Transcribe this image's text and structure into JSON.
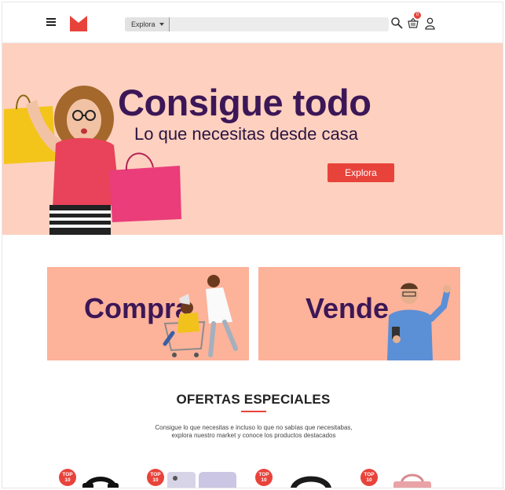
{
  "header": {
    "search": {
      "category": "Explora",
      "placeholder": ""
    },
    "cart_count": "0"
  },
  "hero": {
    "title": "Consigue todo",
    "subtitle": "Lo que necesitas desde casa",
    "button_label": "Explora"
  },
  "promos": [
    {
      "label": "Compra"
    },
    {
      "label": "Vende"
    }
  ],
  "ofertas": {
    "title": "OFERTAS ESPECIALES",
    "description_line1": "Consigue lo que necesitas e incluso lo que no sabías que necesitabas,",
    "description_line2": "explora nuestro market y conoce los productos destacados"
  },
  "products": [
    {
      "badge_top": "TOP",
      "badge_bottom": "10",
      "icon": "headphones-icon"
    },
    {
      "badge_top": "TOP",
      "badge_bottom": "10",
      "icon": "phone-icon"
    },
    {
      "badge_top": "TOP",
      "badge_bottom": "10",
      "icon": "smartwatch-icon"
    },
    {
      "badge_top": "TOP",
      "badge_bottom": "10",
      "icon": "handbag-icon"
    }
  ],
  "colors": {
    "accent": "#e8433b",
    "brand_purple": "#3c1757",
    "hero_bg": "#fdd0bf",
    "card_bg": "#fdb29a"
  }
}
